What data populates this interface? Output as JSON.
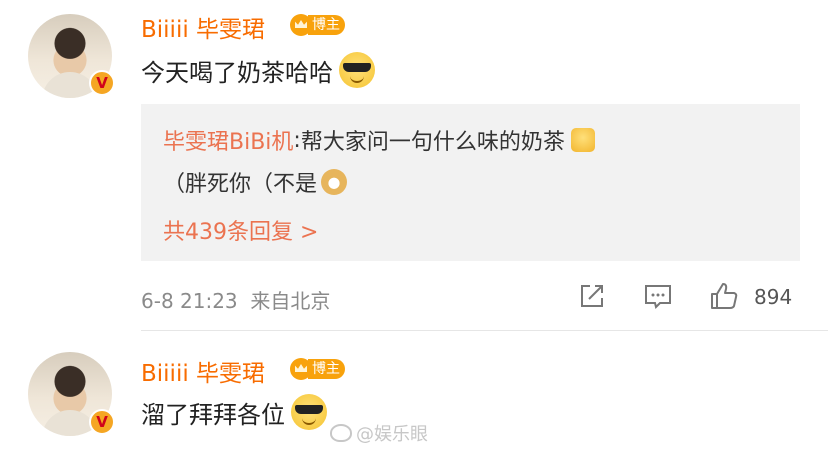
{
  "comments": [
    {
      "username": "Biiiii 毕雯珺",
      "badge": "博主",
      "verified_mark": "V",
      "text": "今天喝了奶茶哈哈",
      "emoji": "cool-sunglasses-face"
    },
    {
      "username": "Biiiii 毕雯珺",
      "badge": "博主",
      "verified_mark": "V",
      "text": "溜了拜拜各位",
      "emoji": "cool-sunglasses-face"
    }
  ],
  "reply": {
    "author": "毕雯珺BiBi机",
    "separator": ":",
    "line1": " 帮大家问一句什么味的奶茶",
    "line2": "（胖死你（不是",
    "more_link": "共439条回复 >"
  },
  "meta": {
    "date": "6-8 21:23",
    "location": "来自北京",
    "likes": "894"
  },
  "watermark": "@娱乐眼",
  "colors": {
    "username": "#f86c00",
    "link": "#eb7350",
    "badge": "#f8a20c"
  }
}
